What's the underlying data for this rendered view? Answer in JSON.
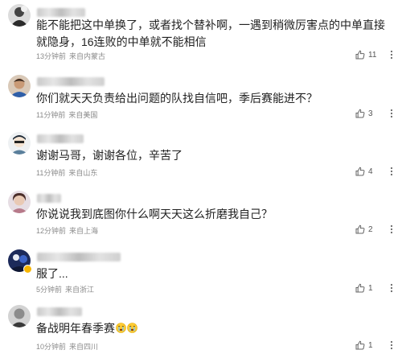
{
  "comments": [
    {
      "text": "能不能把这中单换了，或者找个替补啊，一遇到稍微厉害点的中单直接就隐身，16连败的中单就不能相信",
      "time": "13分钟前",
      "location": "来自内蒙古",
      "likes": "11",
      "emoji_count": 0
    },
    {
      "text": "你们就天天负责给出问题的队找自信吧，季后赛能进不？",
      "time": "11分钟前",
      "location": "来自美国",
      "likes": "3",
      "emoji_count": 0
    },
    {
      "text": "谢谢马哥，谢谢各位，辛苦了",
      "time": "11分钟前",
      "location": "来自山东",
      "likes": "4",
      "emoji_count": 0
    },
    {
      "text": "你说说我到底图你什么啊天天这么折磨我自己？",
      "time": "12分钟前",
      "location": "来自上海",
      "likes": "2",
      "emoji_count": 0
    },
    {
      "text": "服了...",
      "time": "5分钟前",
      "location": "来自浙江",
      "likes": "1",
      "emoji_count": 0
    },
    {
      "text": "备战明年春季赛",
      "time": "10分钟前",
      "location": "来自四川",
      "likes": "1",
      "emoji_count": 2
    }
  ],
  "icons": {
    "like": "thumbs-up-icon",
    "more": "more-vertical-icon",
    "emoji": "sob-emoji-icon"
  },
  "colors": {
    "text": "#222222",
    "meta": "#8a8a8a",
    "icon": "#666666",
    "vip_badge": "#f7b500"
  }
}
